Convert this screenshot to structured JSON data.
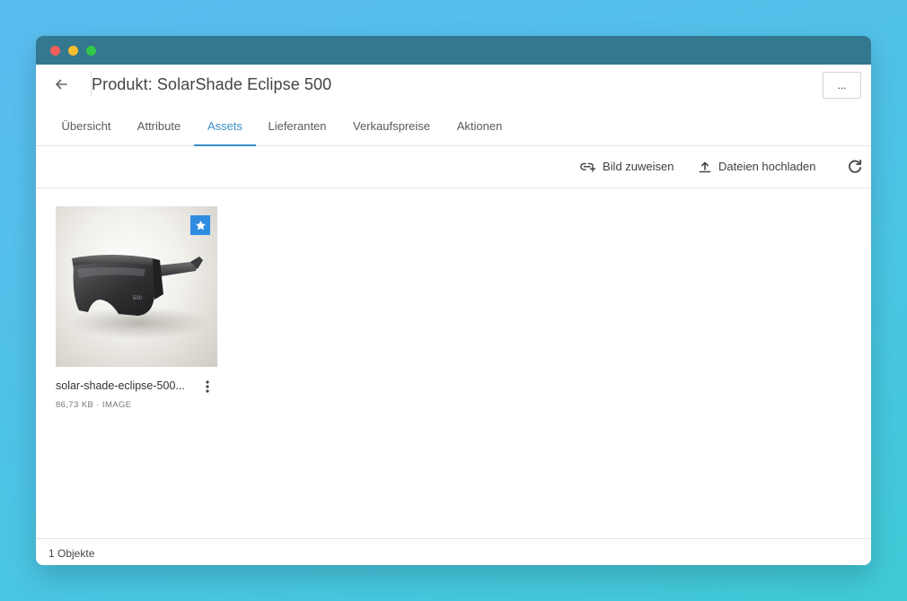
{
  "window": {
    "controls": [
      "close",
      "minimize",
      "maximize"
    ]
  },
  "header": {
    "title": "Produkt: SolarShade Eclipse 500",
    "back_icon": "arrow-left-icon",
    "more_label": "..."
  },
  "tabs": [
    {
      "label": "Übersicht",
      "active": false
    },
    {
      "label": "Attribute",
      "active": false
    },
    {
      "label": "Assets",
      "active": true
    },
    {
      "label": "Lieferanten",
      "active": false
    },
    {
      "label": "Verkaufspreise",
      "active": false
    },
    {
      "label": "Aktionen",
      "active": false
    }
  ],
  "toolbar": {
    "assign_label": "Bild zuweisen",
    "assign_icon": "link-image-icon",
    "upload_label": "Dateien hochladen",
    "upload_icon": "upload-icon",
    "refresh_icon": "refresh-icon"
  },
  "assets": [
    {
      "name": "solar-shade-eclipse-500...",
      "size": "86,73 KB",
      "type": "IMAGE",
      "meta": "86,73 KB · IMAGE",
      "primary": true
    }
  ],
  "footer": {
    "count_label": "1 Objekte"
  },
  "colors": {
    "titlebar": "#34788f",
    "accent": "#3a8fc9",
    "badge": "#2f8ce0"
  }
}
